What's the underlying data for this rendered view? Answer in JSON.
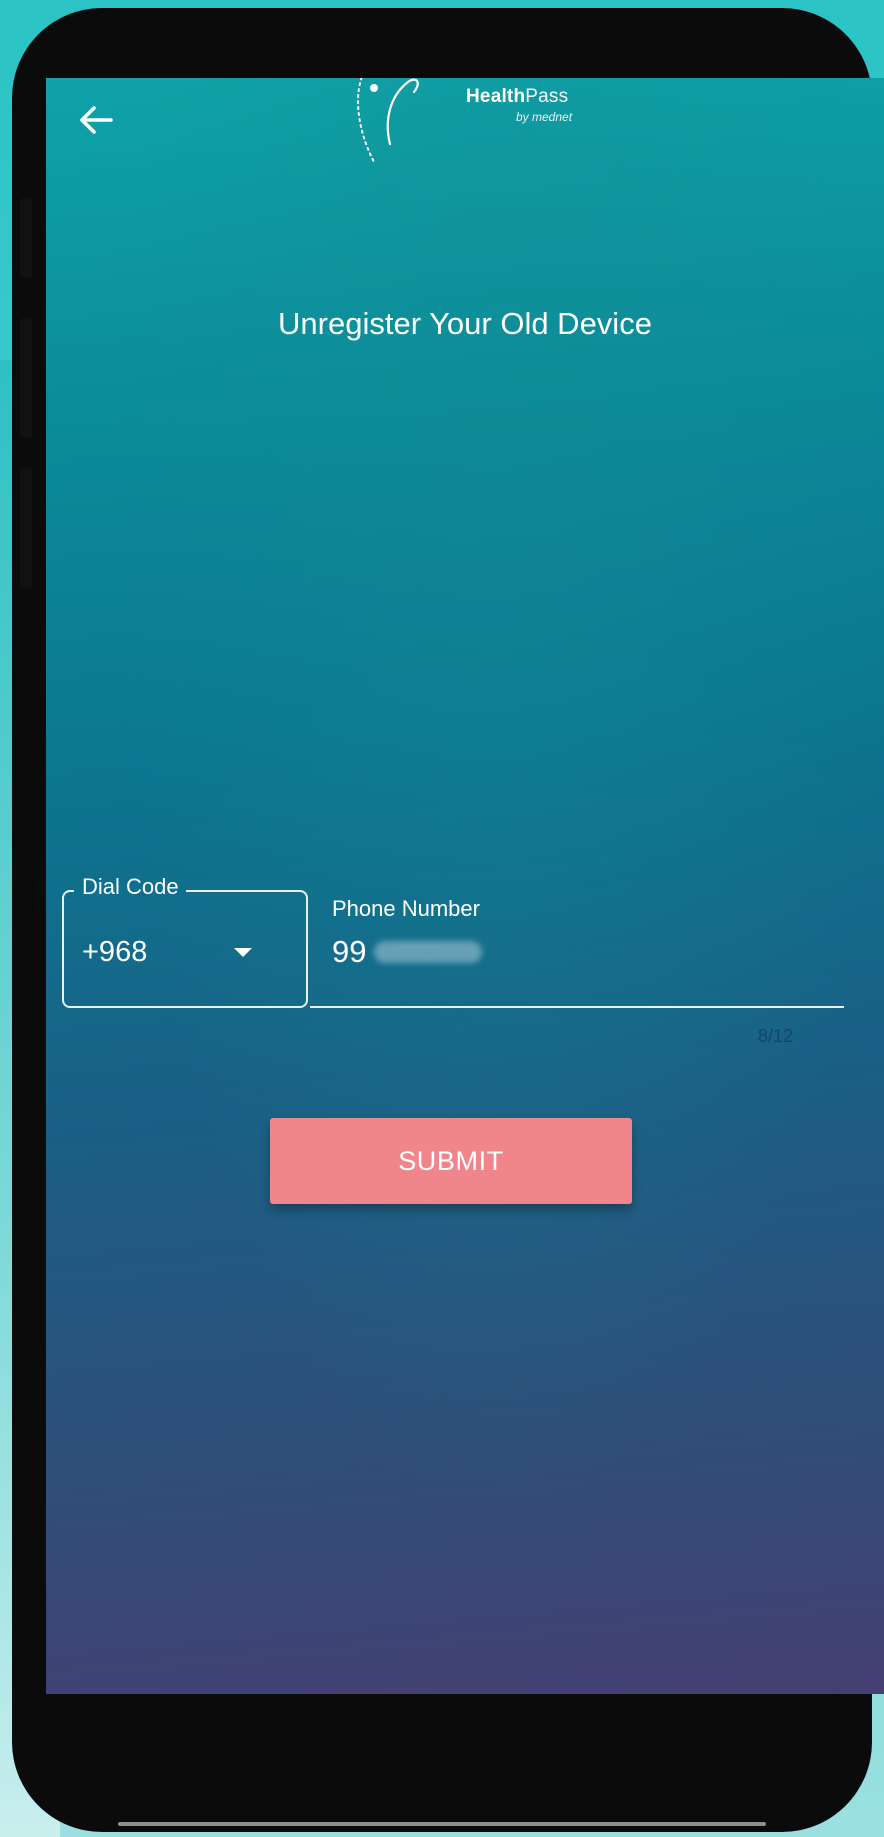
{
  "app": {
    "logo_name_bold": "Health",
    "logo_name_light": "Pass",
    "logo_sub": "by mednet"
  },
  "header": {
    "back_icon": "arrow-left-icon"
  },
  "main": {
    "title": "Unregister Your Old Device"
  },
  "form": {
    "dial_code": {
      "label": "Dial Code",
      "value": "+968",
      "icon": "caret-down-icon"
    },
    "phone_number": {
      "label": "Phone Number",
      "value_visible": "99",
      "counter": "8/12"
    },
    "submit_label": "SUBMIT"
  },
  "colors": {
    "gradient_top": "#0fa3a8",
    "gradient_bottom": "#453f72",
    "submit_button": "#f0858c",
    "text": "#ffffff"
  }
}
